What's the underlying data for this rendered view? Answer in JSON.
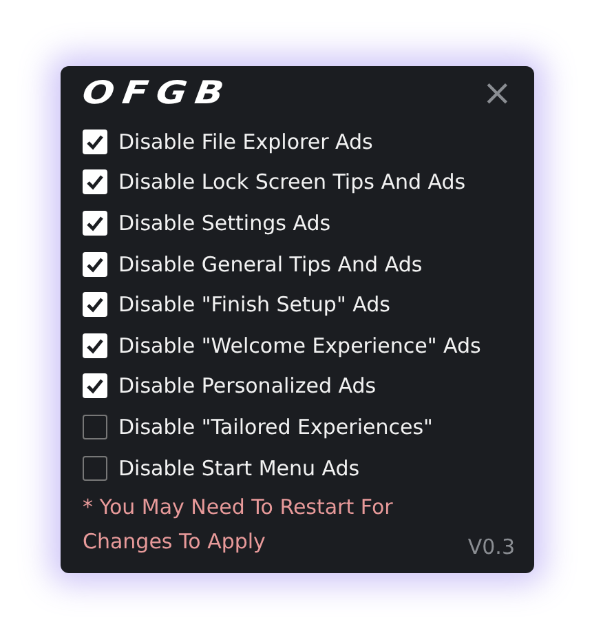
{
  "window": {
    "logo": "OFGB",
    "close": "×"
  },
  "options": [
    {
      "label": "Disable File Explorer Ads",
      "checked": true
    },
    {
      "label": "Disable Lock Screen Tips And Ads",
      "checked": true
    },
    {
      "label": "Disable Settings Ads",
      "checked": true
    },
    {
      "label": "Disable General Tips And Ads",
      "checked": true
    },
    {
      "label": "Disable \"Finish Setup\" Ads",
      "checked": true
    },
    {
      "label": "Disable \"Welcome Experience\" Ads",
      "checked": true
    },
    {
      "label": "Disable Personalized Ads",
      "checked": true
    },
    {
      "label": "Disable \"Tailored Experiences\"",
      "checked": false
    },
    {
      "label": "Disable Start Menu Ads",
      "checked": false
    }
  ],
  "note": "* You May Need To Restart For Changes To Apply",
  "version": "V0.3"
}
